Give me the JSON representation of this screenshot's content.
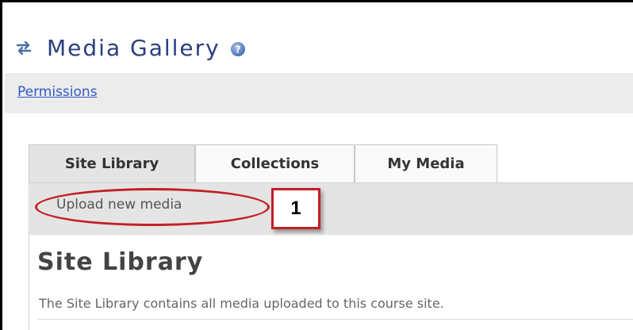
{
  "header": {
    "title": "Media Gallery"
  },
  "nav": {
    "permissions_label": "Permissions"
  },
  "tabs": [
    {
      "label": "Site Library",
      "active": true
    },
    {
      "label": "Collections",
      "active": false
    },
    {
      "label": "My Media",
      "active": false
    }
  ],
  "toolbar": {
    "upload_label": "Upload new media"
  },
  "annotation": {
    "step_number": "1",
    "color": "#c31e24"
  },
  "section": {
    "title": "Site Library",
    "description": "The Site Library contains all media uploaded to this course site."
  },
  "icons": {
    "reset": "reset-icon",
    "help": "help-icon"
  },
  "colors": {
    "title": "#2b3e7e",
    "link": "#2f58c3",
    "tab_active_bg": "#e4e4e4"
  }
}
